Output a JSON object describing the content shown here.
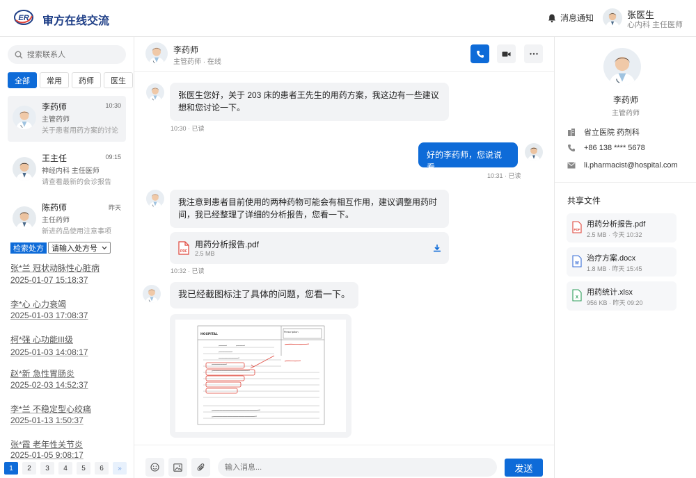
{
  "app": {
    "title": "审方在线交流",
    "logo_text": "ER"
  },
  "header": {
    "notify_label": "消息通知",
    "user": {
      "name": "张医生",
      "role": "心内科 主任医师"
    }
  },
  "sidebar": {
    "search_placeholder": "搜索联系人",
    "filters": [
      "全部",
      "常用",
      "药师",
      "医生"
    ],
    "contacts": [
      {
        "name": "李药师",
        "time": "10:30",
        "role": "主管药师",
        "preview": "关于患者用药方案的讨论"
      },
      {
        "name": "王主任",
        "time": "09:15",
        "role": "神经内科 主任医师",
        "preview": "请查看最新的会诊报告"
      },
      {
        "name": "陈药师",
        "time": "昨天",
        "role": "主任药师",
        "preview": "新进药品使用注意事项"
      }
    ],
    "rx_search_label": "检索处方",
    "rx_select_placeholder": "请输入处方号",
    "rx_items": [
      {
        "title": "张*兰  冠状动脉性心脏病",
        "date": "2025-01-07 15:18:37"
      },
      {
        "title": "李*心  心力衰竭",
        "date": "2025-01-03 17:08:37"
      },
      {
        "title": "柯*强  心功能III级",
        "date": "2025-01-03 14:08:17"
      },
      {
        "title": "赵*新  急性胃肠炎",
        "date": "2025-02-03 14:52:37"
      },
      {
        "title": "李*兰  不稳定型心绞痛",
        "date": "2025-01-13 1:50:37"
      },
      {
        "title": "张*霞  老年性关节炎",
        "date": "2025-01-05 9:08:17"
      }
    ],
    "pages": [
      "1",
      "2",
      "3",
      "4",
      "5",
      "6",
      "»"
    ]
  },
  "chat": {
    "contact_name": "李药师",
    "contact_status": "主管药师 · 在线",
    "messages": [
      {
        "text": "张医生您好，关于 203 床的患者王先生的用药方案，我这边有一些建议想和您讨论一下。",
        "meta": "10:30 · 已读"
      },
      {
        "text": "好的李药师，您说说看。",
        "meta": "10:31 · 已读"
      },
      {
        "text": "我注意到患者目前使用的两种药物可能会有相互作用，建议调整用药时间，我已经整理了详细的分析报告，您看一下。",
        "meta": "10:32 · 已读"
      },
      {
        "text": "我已经截图标注了具体的问题，您看一下。"
      }
    ],
    "attachment": {
      "name": "用药分析报告.pdf",
      "size": "2.5 MB",
      "type_label": "PDF"
    },
    "input_placeholder": "输入消息...",
    "send_label": "发送"
  },
  "profile": {
    "name": "李药师",
    "role": "主管药师",
    "hospital": "省立医院 药剂科",
    "phone": "+86 138 **** 5678",
    "email": "li.pharmacist@hospital.com",
    "shared_title": "共享文件",
    "files": [
      {
        "name": "用药分析报告.pdf",
        "meta": "2.5 MB · 今天 10:32",
        "type": "pdf",
        "type_label": "PDF"
      },
      {
        "name": "治疗方案.docx",
        "meta": "1.8 MB · 昨天 15:45",
        "type": "docx",
        "type_label": "W"
      },
      {
        "name": "用药统计.xlsx",
        "meta": "956 KB · 昨天 09:20",
        "type": "xlsx",
        "type_label": "X"
      }
    ]
  },
  "prescription_image": {
    "header": "HOSPITAL",
    "box_label": "Prescription"
  },
  "colors": {
    "primary": "#0e6bd8",
    "brand": "#1f3f87",
    "pdf_red": "#e0453a",
    "doc_blue": "#3b6fd8",
    "xls_green": "#2e9e5b"
  }
}
